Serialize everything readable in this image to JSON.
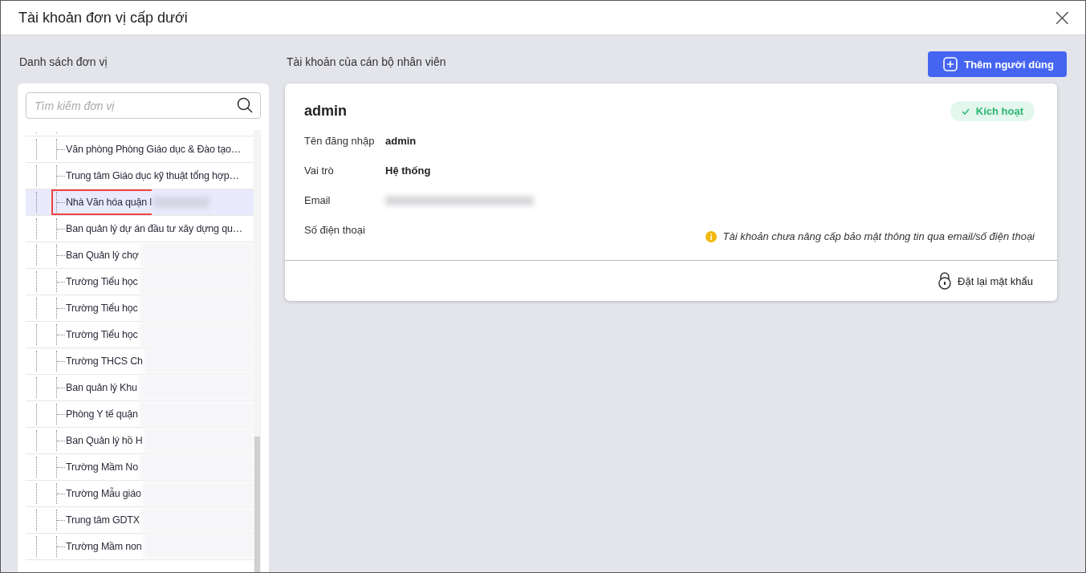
{
  "dialog": {
    "title": "Tài khoản đơn vị cấp dưới",
    "close": "×"
  },
  "units": {
    "heading": "Danh sách đơn vị",
    "search": {
      "placeholder": "Tìm kiếm đơn vị"
    },
    "items": [
      {
        "label": "Văn phòng Phòng Giáo dục & Đào tạo…",
        "selected": false,
        "redacted": false
      },
      {
        "label": "Trung tâm Giáo dục kỹ thuật tổng hợp…",
        "selected": false,
        "redacted": false
      },
      {
        "label": "Nhà Văn hóa quận l",
        "selected": true,
        "redacted": true
      },
      {
        "label": "Ban quản lý dự án đầu tư xây dựng qu…",
        "selected": false,
        "redacted": false
      },
      {
        "label": "Ban Quản lý chợ",
        "selected": false,
        "redacted": true
      },
      {
        "label": "Trường Tiểu học",
        "selected": false,
        "redacted": true
      },
      {
        "label": "Trường Tiểu học",
        "selected": false,
        "redacted": true
      },
      {
        "label": "Trường Tiểu học",
        "selected": false,
        "redacted": true
      },
      {
        "label": "Trường THCS Ch",
        "selected": false,
        "redacted": true
      },
      {
        "label": "Ban quản lý Khu",
        "selected": false,
        "redacted": true
      },
      {
        "label": "Phòng Y tế quận",
        "selected": false,
        "redacted": true
      },
      {
        "label": "Ban Quản lý hồ H",
        "selected": false,
        "redacted": true
      },
      {
        "label": "Trường Mầm No",
        "selected": false,
        "redacted": true
      },
      {
        "label": "Trường Mẫu giáo",
        "selected": false,
        "redacted": true
      },
      {
        "label": "Trung tâm GDTX",
        "selected": false,
        "redacted": true
      },
      {
        "label": "Trường Mầm non",
        "selected": false,
        "redacted": true
      }
    ]
  },
  "accounts": {
    "heading": "Tài khoản của cán bộ nhân viên",
    "add_button": "Thêm người dùng",
    "card": {
      "name": "admin",
      "status": "Kích hoạt",
      "fields": [
        {
          "label": "Tên đăng nhập",
          "value": "admin"
        },
        {
          "label": "Vai trò",
          "value": "Hệ thống"
        },
        {
          "label": "Email",
          "redacted": true
        },
        {
          "label": "Số điện thoại"
        }
      ],
      "warning": "Tài khoản chưa nâng cấp bảo mật thông tin qua email/số điện thoại",
      "reset_button": "Đặt lại mật khẩu"
    }
  }
}
